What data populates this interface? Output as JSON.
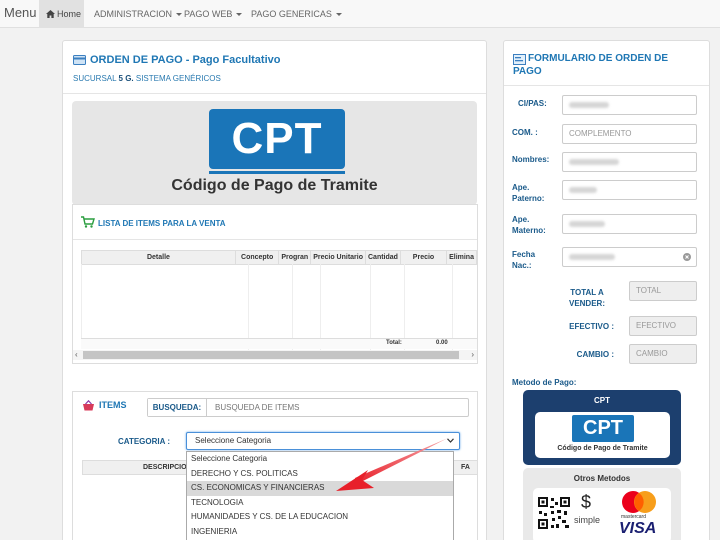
{
  "navbar": {
    "brand": "Menu",
    "items": [
      {
        "label": "Home"
      },
      {
        "label": "ADMINISTRACION"
      },
      {
        "label": "PAGO WEB"
      },
      {
        "label": "PAGO GENERICAS"
      }
    ]
  },
  "order": {
    "title": "ORDEN DE PAGO - Pago Facultativo",
    "sucursal_prefix": "SUCURSAL",
    "sucursal_value": "5 G.",
    "sucursal_suffix": "SISTEMA GENÉRICOS",
    "banner_logo": "CPT",
    "banner_caption": "Código de Pago de Tramite",
    "list_title": "LISTA DE ITEMS PARA LA VENTA",
    "table_headers": [
      "Detalle",
      "Concepto",
      "Progran",
      "Precio Unitario",
      "Cantidad",
      "Precio",
      "Elimina"
    ],
    "total_label": "Total:",
    "total_value": "0.00"
  },
  "items": {
    "title": "ITEMS",
    "search_label": "BUSQUEDA:",
    "search_placeholder": "BUSQUEDA DE ITEMS",
    "category_label": "CATEGORIA :",
    "category_selected": "Seleccione Categoria",
    "table_headers": [
      "DESCRIPCION",
      "FA"
    ],
    "options": [
      "Seleccione Categoria",
      "DERECHO Y CS. POLITICAS",
      "CS. ECONOMICAS Y FINANCIERAS",
      "TECNOLOGIA",
      "HUMANIDADES Y CS. DE LA EDUCACION",
      "INGENIERIA"
    ],
    "highlighted_option": "CS. ECONOMICAS Y FINANCIERAS"
  },
  "form": {
    "title_line1": "FORMULARIO DE ORDEN DE",
    "title_line2": "PAGO",
    "fields": [
      {
        "label": "CI/PAS:",
        "placeholder": ""
      },
      {
        "label": "COM. :",
        "placeholder": "COMPLEMENTO"
      },
      {
        "label": "Nombres:",
        "placeholder": ""
      },
      {
        "label_line1": "Ape.",
        "label_line2": "Paterno:",
        "placeholder": ""
      },
      {
        "label_line1": "Ape.",
        "label_line2": "Materno:",
        "placeholder": ""
      },
      {
        "label_line1": "Fecha",
        "label_line2": "Nac.:",
        "placeholder": ""
      }
    ],
    "total_label_line1": "TOTAL A",
    "total_label_line2": "VENDER:",
    "total_placeholder": "TOTAL",
    "efectivo_label": "EFECTIVO :",
    "efectivo_placeholder": "EFECTIVO",
    "cambio_label": "CAMBIO :",
    "cambio_placeholder": "CAMBIO",
    "payment_method_label": "Metodo de Pago:",
    "payment_cpt_title": "CPT",
    "payment_cpt_logo": "CPT",
    "payment_cpt_caption": "Código de Pago de Tramite",
    "payment_other_title": "Otros Metodos",
    "simple_label": "simple",
    "mastercard_label": "mastercard",
    "visa_label": "VISA"
  },
  "colors": {
    "accent": "#1f77b4",
    "cpt_blue": "#1a75b8",
    "navy": "#1c3f6e",
    "arrow": "#e8202a"
  }
}
